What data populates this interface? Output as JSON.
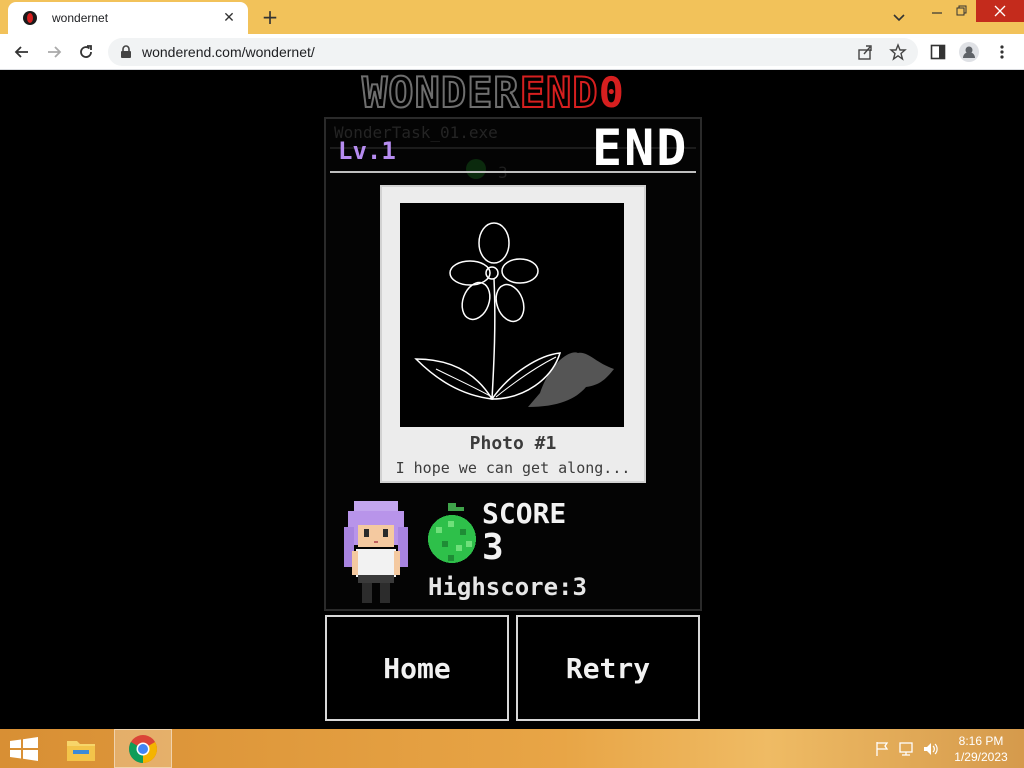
{
  "browser": {
    "tab_title": "wondernet",
    "tab_close_glyph": "✕",
    "new_tab_glyph": "+",
    "url": "wonderend.com/wondernet/",
    "accent_color": "#f2c25a",
    "close_button_color": "#c42b1c"
  },
  "game": {
    "logo_gray_text": "WONDER",
    "logo_red_text": "END",
    "logo_zero": "0",
    "ghost_title": "WonderTask_01.exe",
    "ghost_count": "3",
    "level": "Lv.1",
    "end_title": "END",
    "photo": {
      "title": "Photo #1",
      "caption": "I hope we can get along..."
    },
    "score_label": "SCORE",
    "score_value": "3",
    "highscore": "Highscore:3",
    "buttons": {
      "home": "Home",
      "retry": "Retry"
    },
    "colors": {
      "level_purple": "#b68cf0",
      "logo_red": "#d61f1f",
      "melon_green": "#2ec04a"
    }
  },
  "taskbar": {
    "time": "8:16 PM",
    "date": "1/29/2023",
    "icons": [
      "windows-start-icon",
      "file-explorer-icon",
      "chrome-icon",
      "flag-icon",
      "network-icon",
      "volume-icon"
    ]
  }
}
